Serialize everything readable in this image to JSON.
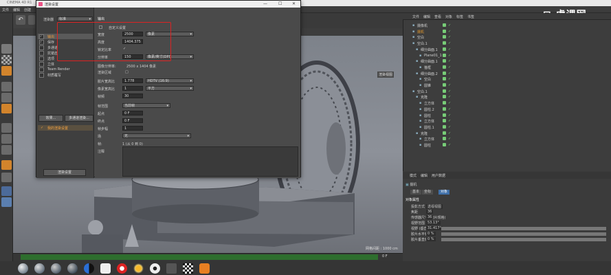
{
  "app": {
    "title": "CINEMA 4D R1",
    "menu": [
      "文件",
      "编辑",
      "创建"
    ],
    "logo_text": "虎课网"
  },
  "dialog": {
    "title": "渲染设置",
    "renderer_label": "渲染器",
    "renderer_value": "标准",
    "left_items": [
      {
        "label": "输出",
        "checked": true,
        "active": true
      },
      {
        "label": "保存",
        "checked": true
      },
      {
        "label": "多通道",
        "checked": false
      },
      {
        "label": "抗锯齿",
        "checked": false
      },
      {
        "label": "选项",
        "checked": false
      },
      {
        "label": "立体",
        "checked": false
      },
      {
        "label": "Team Render",
        "checked": false
      },
      {
        "label": "材质覆写",
        "checked": false
      }
    ],
    "effect_button": "效果...",
    "multipass_button": "多通道渲染...",
    "preset_label": "我的渲染设置",
    "render_settings_button": "渲染设置",
    "section_title": "输出",
    "preset_check": "自定义设置",
    "width_label": "宽度",
    "width_value": "2500",
    "width_unit": "像素",
    "height_label": "高度",
    "height_value": "1404.375",
    "lock_ratio_label": "锁定比率",
    "lock_ratio_value": "✓",
    "resolution_label": "分辨率",
    "resolution_value": "150",
    "resolution_unit": "像素/英寸(DPI)",
    "image_res_label": "图像分辨率:",
    "image_res_value": "2500 x 1404 像素",
    "render_region_label": "渲染区域",
    "render_region_value": "□",
    "film_aspect_label": "胶片宽高比",
    "film_aspect_value": "1.778",
    "film_aspect_preset": "HDTV (16:9)",
    "pixel_aspect_label": "像素宽高比",
    "pixel_aspect_value": "1",
    "pixel_aspect_preset": "平方",
    "fps_label": "帧频",
    "fps_value": "30",
    "frame_range_label": "帧范围",
    "frame_range_value": "当前帧",
    "start_label": "起点",
    "start_value": "0 F",
    "end_label": "终点",
    "end_value": "0 F",
    "step_label": "帧步幅",
    "step_value": "1",
    "fields_label": "场",
    "fields_value": "无",
    "frames_label": "帧:",
    "frames_value": "1 (从 0 到 0)",
    "notes_label": "注释"
  },
  "viewport": {
    "status": "网格间距 : 1000 cm",
    "label": "渲染视图",
    "timeline_number": "0 F"
  },
  "object_manager": {
    "menu": [
      "文件",
      "编辑",
      "查看",
      "对象",
      "标签",
      "书签"
    ],
    "objects": [
      {
        "name": "摄像机",
        "indent": 0
      },
      {
        "name": "摄机",
        "indent": 0
      },
      {
        "name": "空白",
        "indent": 0
      },
      {
        "name": "空白.1",
        "indent": 0
      },
      {
        "name": "细分曲面.1",
        "indent": 1
      },
      {
        "name": "Plane01_1",
        "indent": 2
      },
      {
        "name": "细分曲面.1",
        "indent": 1
      },
      {
        "name": "猫框",
        "indent": 2
      },
      {
        "name": "细分曲面.2",
        "indent": 1
      },
      {
        "name": "空白",
        "indent": 2
      },
      {
        "name": "圆锥",
        "indent": 2
      },
      {
        "name": "空白.1",
        "indent": 0
      },
      {
        "name": "克隆",
        "indent": 1
      },
      {
        "name": "立方体",
        "indent": 2
      },
      {
        "name": "圆柱.2",
        "indent": 2
      },
      {
        "name": "圆柱",
        "indent": 2
      },
      {
        "name": "立方体",
        "indent": 2
      },
      {
        "name": "圆柱.1",
        "indent": 2
      },
      {
        "name": "克隆",
        "indent": 1
      },
      {
        "name": "立方体",
        "indent": 2
      },
      {
        "name": "圆柱",
        "indent": 2
      }
    ]
  },
  "attribute_manager": {
    "menu": [
      "模式",
      "编辑",
      "用户数据"
    ],
    "object_name": "摄机",
    "tabs": [
      "基本",
      "坐标",
      "对象",
      "细节",
      "合成"
    ],
    "section": "对象属性",
    "rows": [
      {
        "label": "投影方式",
        "value": "透视视图"
      },
      {
        "label": "焦距",
        "value": "36"
      },
      {
        "label": "传感器尺寸 (胶片规格)",
        "value": "36"
      },
      {
        "label": "视野范围",
        "value": "53.13°"
      },
      {
        "label": "视野 (垂直)",
        "value": "31.417°"
      },
      {
        "label": "胶片水平偏移",
        "value": "0 %"
      },
      {
        "label": "胶片垂直偏移",
        "value": "0 %"
      }
    ]
  },
  "colors": {
    "accent_orange": "#e59a2c",
    "highlight_red": "#dd2222",
    "selected_blue": "#3f6fa8"
  }
}
